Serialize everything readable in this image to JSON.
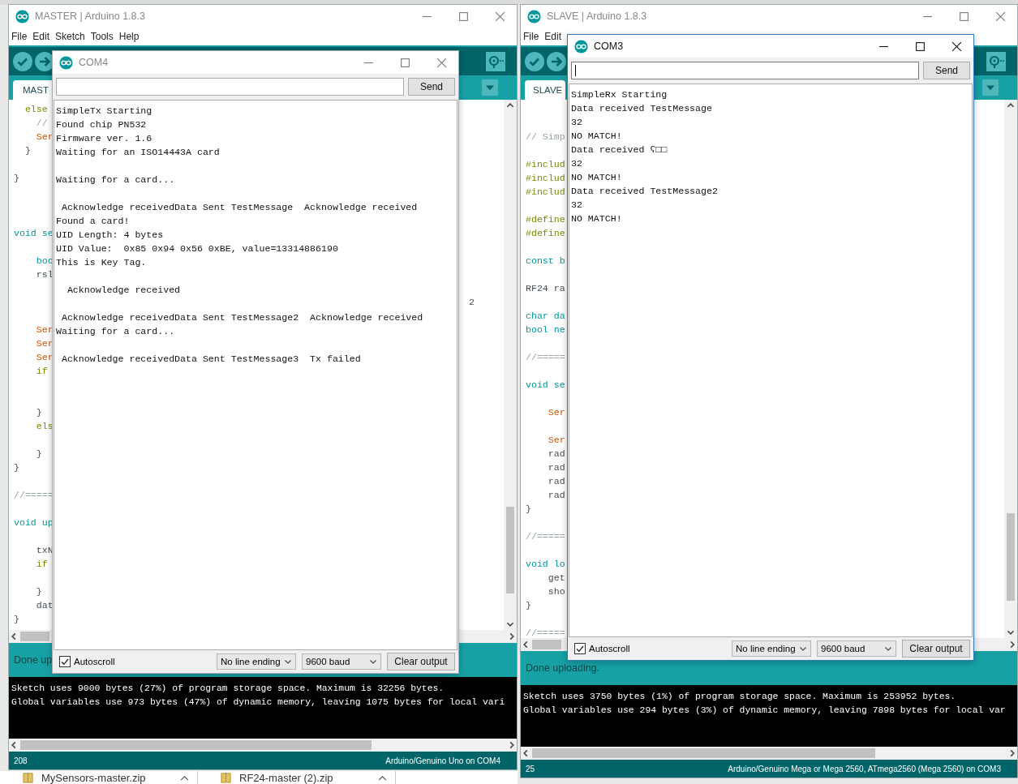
{
  "windows": [
    {
      "title": "MASTER | Arduino 1.8.3",
      "menu": [
        "File",
        "Edit",
        "Sketch",
        "Tools",
        "Help"
      ],
      "tabs": [
        {
          "label": "MAST",
          "selected": true
        }
      ],
      "code_lines": [
        {
          "kind": "control",
          "text": "  else"
        },
        {
          "kind": "comment",
          "text": "    //"
        },
        {
          "kind": "function",
          "text": "    Ser"
        },
        {
          "kind": "plain",
          "text": "  }"
        },
        {
          "kind": "blank"
        },
        {
          "kind": "plain",
          "text": "}"
        },
        {
          "kind": "blank"
        },
        {
          "kind": "blank"
        },
        {
          "kind": "blank"
        },
        {
          "kind": "type",
          "text": "void se"
        },
        {
          "kind": "blank"
        },
        {
          "kind": "type",
          "text": "    boo"
        },
        {
          "kind": "plain",
          "text": "    rsl"
        },
        {
          "kind": "blank"
        },
        {
          "kind": "blank",
          "tail": "2"
        },
        {
          "kind": "blank"
        },
        {
          "kind": "function",
          "text": "    Ser"
        },
        {
          "kind": "function",
          "text": "    Ser"
        },
        {
          "kind": "function",
          "text": "    Ser"
        },
        {
          "kind": "control",
          "text": "    if"
        },
        {
          "kind": "blank"
        },
        {
          "kind": "blank"
        },
        {
          "kind": "plain",
          "text": "    }"
        },
        {
          "kind": "control",
          "text": "    els"
        },
        {
          "kind": "blank"
        },
        {
          "kind": "plain",
          "text": "    }"
        },
        {
          "kind": "plain",
          "text": "}"
        },
        {
          "kind": "blank"
        },
        {
          "kind": "comment",
          "text": "//====="
        },
        {
          "kind": "blank"
        },
        {
          "kind": "type",
          "text": "void up"
        },
        {
          "kind": "blank"
        },
        {
          "kind": "plain",
          "text": "    txN"
        },
        {
          "kind": "control",
          "text": "    if"
        },
        {
          "kind": "blank"
        },
        {
          "kind": "plain",
          "text": "    }"
        },
        {
          "kind": "plain",
          "text": "    dat"
        },
        {
          "kind": "plain",
          "text": "}"
        }
      ],
      "status": "Done up",
      "console_lines": [
        "Sketch uses 9000 bytes (27%) of program storage space. Maximum is 32256 bytes.",
        "Global variables use 973 bytes (47%) of dynamic memory, leaving 1075 bytes for local vari"
      ],
      "line_number": "208",
      "board": "Arduino/Genuino Uno on COM4",
      "serial_monitor": {
        "title": "COM4",
        "active": false,
        "send": "Send",
        "output": [
          {
            "kind": "text",
            "text": "SimpleTx Starting"
          },
          {
            "kind": "text",
            "text": "Found chip PN532"
          },
          {
            "kind": "text",
            "text": "Firmware ver. 1.6"
          },
          {
            "kind": "text",
            "text": "Waiting for an ISO14443A card"
          },
          {
            "kind": "blank"
          },
          {
            "kind": "text",
            "text": "Waiting for a card..."
          },
          {
            "kind": "blank"
          },
          {
            "kind": "text",
            "text": " Acknowledge receivedData Sent TestMessage  Acknowledge received"
          },
          {
            "kind": "text",
            "text": "Found a card!"
          },
          {
            "kind": "text",
            "text": "UID Length: 4 bytes"
          },
          {
            "kind": "text",
            "text": "UID Value:  0x85 0x94 0x56 0xBE, value=13314886190"
          },
          {
            "kind": "text",
            "text": "This is Key Tag."
          },
          {
            "kind": "blank"
          },
          {
            "kind": "text",
            "text": "  Acknowledge received"
          },
          {
            "kind": "blank"
          },
          {
            "kind": "text",
            "text": " Acknowledge receivedData Sent TestMessage2  Acknowledge received"
          },
          {
            "kind": "text",
            "text": "Waiting for a card..."
          },
          {
            "kind": "blank"
          },
          {
            "kind": "text",
            "text": " Acknowledge receivedData Sent TestMessage3  Tx failed"
          }
        ],
        "autoscroll_label": "Autoscroll",
        "autoscroll": true,
        "line_ending": "No line ending",
        "baud": "9600 baud",
        "clear": "Clear output"
      }
    },
    {
      "title": "SLAVE | Arduino 1.8.3",
      "menu": [
        "File",
        "Edit"
      ],
      "tabs": [
        {
          "label": "SLAVE",
          "selected": true
        }
      ],
      "code_lines": [
        {
          "kind": "blank"
        },
        {
          "kind": "blank"
        },
        {
          "kind": "comment",
          "text": "// Simp"
        },
        {
          "kind": "blank"
        },
        {
          "kind": "preprocessor",
          "text": "#includ"
        },
        {
          "kind": "preprocessor",
          "text": "#includ"
        },
        {
          "kind": "preprocessor",
          "text": "#includ"
        },
        {
          "kind": "blank"
        },
        {
          "kind": "preprocessor",
          "text": "#define"
        },
        {
          "kind": "preprocessor",
          "text": "#define"
        },
        {
          "kind": "blank"
        },
        {
          "kind": "type",
          "text": "const b"
        },
        {
          "kind": "blank"
        },
        {
          "kind": "plain",
          "text": "RF24 ra"
        },
        {
          "kind": "blank"
        },
        {
          "kind": "type",
          "text": "char da"
        },
        {
          "kind": "type",
          "text": "bool ne"
        },
        {
          "kind": "blank"
        },
        {
          "kind": "comment",
          "text": "//====="
        },
        {
          "kind": "blank"
        },
        {
          "kind": "type",
          "text": "void se"
        },
        {
          "kind": "blank"
        },
        {
          "kind": "function",
          "text": "    Ser"
        },
        {
          "kind": "blank"
        },
        {
          "kind": "function",
          "text": "    Ser"
        },
        {
          "kind": "plain",
          "text": "    rad"
        },
        {
          "kind": "plain",
          "text": "    rad"
        },
        {
          "kind": "plain",
          "text": "    rad"
        },
        {
          "kind": "plain",
          "text": "    rad"
        },
        {
          "kind": "plain",
          "text": "}"
        },
        {
          "kind": "blank"
        },
        {
          "kind": "comment",
          "text": "//====="
        },
        {
          "kind": "blank"
        },
        {
          "kind": "type",
          "text": "void lo"
        },
        {
          "kind": "plain",
          "text": "    get"
        },
        {
          "kind": "plain",
          "text": "    sho"
        },
        {
          "kind": "plain",
          "text": "}"
        },
        {
          "kind": "blank"
        },
        {
          "kind": "comment",
          "text": "//====="
        }
      ],
      "status": "Done uploading.",
      "console_lines": [
        "Sketch uses 3750 bytes (1%) of program storage space. Maximum is 253952 bytes.",
        "Global variables use 294 bytes (3%) of dynamic memory, leaving 7898 bytes for local var"
      ],
      "line_number": "25",
      "board": "Arduino/Genuino Mega or Mega 2560, ATmega2560 (Mega 2560) on COM3",
      "serial_monitor": {
        "title": "COM3",
        "active": true,
        "send": "Send",
        "output": [
          {
            "kind": "text",
            "text": "SimpleRx Starting"
          },
          {
            "kind": "text",
            "text": "Data received TestMessage"
          },
          {
            "kind": "text",
            "text": "32"
          },
          {
            "kind": "text",
            "text": "NO MATCH!"
          },
          {
            "kind": "text",
            "text": "Data received ʕ□□"
          },
          {
            "kind": "text",
            "text": "32"
          },
          {
            "kind": "text",
            "text": "NO MATCH!"
          },
          {
            "kind": "text",
            "text": "Data received TestMessage2"
          },
          {
            "kind": "text",
            "text": "32"
          },
          {
            "kind": "text",
            "text": "NO MATCH!"
          }
        ],
        "autoscroll_label": "Autoscroll",
        "autoscroll": true,
        "line_ending": "No line ending",
        "baud": "9600 baud",
        "clear": "Clear output"
      }
    }
  ],
  "downloads": [
    {
      "name": "MySensors-master.zip"
    },
    {
      "name": "RF24-master (2).zip"
    }
  ]
}
